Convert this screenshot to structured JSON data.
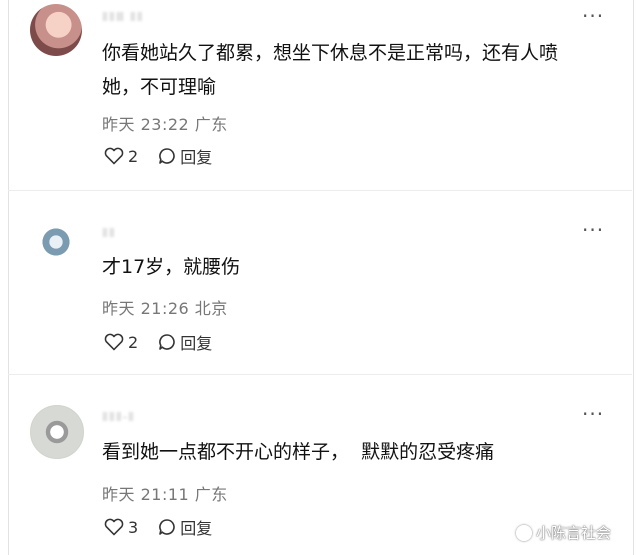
{
  "comments": [
    {
      "username": "ⅡⅡⅢ ⅡⅡ",
      "text": "你看她站久了都累，想坐下休息不是正常吗，还有人喷\n她，不可理喻",
      "time": "昨天 23:22",
      "location": "广东",
      "likes": "2",
      "reply": "回复"
    },
    {
      "username": "ⅡⅡ",
      "text": "才17岁，就腰伤",
      "time": "昨天 21:26",
      "location": "北京",
      "likes": "2",
      "reply": "回复"
    },
    {
      "username": "ⅡⅡⅡ-Ⅱ",
      "text": "看到她一点都不开心的样子，  默默的忍受疼痛",
      "time": "昨天 21:11",
      "location": "广东",
      "likes": "3",
      "reply": "回复"
    }
  ],
  "more_glyph": "···",
  "watermark": "小陈言社会"
}
